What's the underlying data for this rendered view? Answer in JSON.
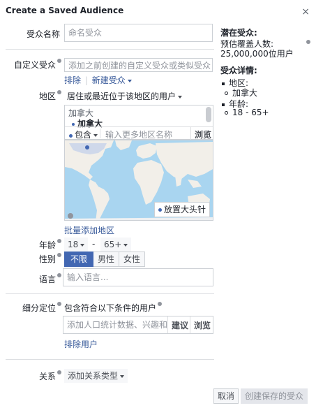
{
  "dialog": {
    "title": "Create a Saved Audience",
    "close_icon": "×"
  },
  "name": {
    "label": "受众名称",
    "placeholder": "命名受众"
  },
  "custom": {
    "label": "自定义受众",
    "placeholder": "添加之前创建的自定义受众或类似受众",
    "exclude": "排除",
    "create_new": "新建受众"
  },
  "region": {
    "label": "地区",
    "selector": "居住或最近位于该地区的用户",
    "country_heading": "加拿大",
    "country_item": "加拿大",
    "include": "包含",
    "search_placeholder": "输入更多地区名称",
    "browse": "浏览",
    "pin": "放置大头针",
    "bulk_add": "批量添加地区"
  },
  "age": {
    "label": "年龄",
    "min": "18",
    "dash": "-",
    "max": "65+"
  },
  "gender": {
    "label": "性别",
    "options": [
      "不限",
      "男性",
      "女性"
    ]
  },
  "language": {
    "label": "语言",
    "placeholder": "输入语言..."
  },
  "detailed": {
    "label": "细分定位",
    "subtitle": "包含符合以下条件的用户",
    "placeholder": "添加人口统计数据、兴趣和",
    "suggest": "建议",
    "browse": "浏览",
    "exclude": "排除用户"
  },
  "relation": {
    "label": "关系",
    "selector": "添加关系类型"
  },
  "footer": {
    "cancel": "取消",
    "save": "创建保存的受众"
  },
  "sidebar": {
    "potential_title": "潜在受众:",
    "reach_label": "预估覆盖人数:",
    "reach_value": "25,000,000位用户",
    "details_title": "受众详情:",
    "region_label": "地区:",
    "region_value": "加拿大",
    "age_label": "年龄:",
    "age_value": "18 - 65+"
  },
  "colors": {
    "accent": "#4267b2",
    "link": "#365899",
    "map_water": "#a9d5f0",
    "map_land": "#f2efe9"
  }
}
